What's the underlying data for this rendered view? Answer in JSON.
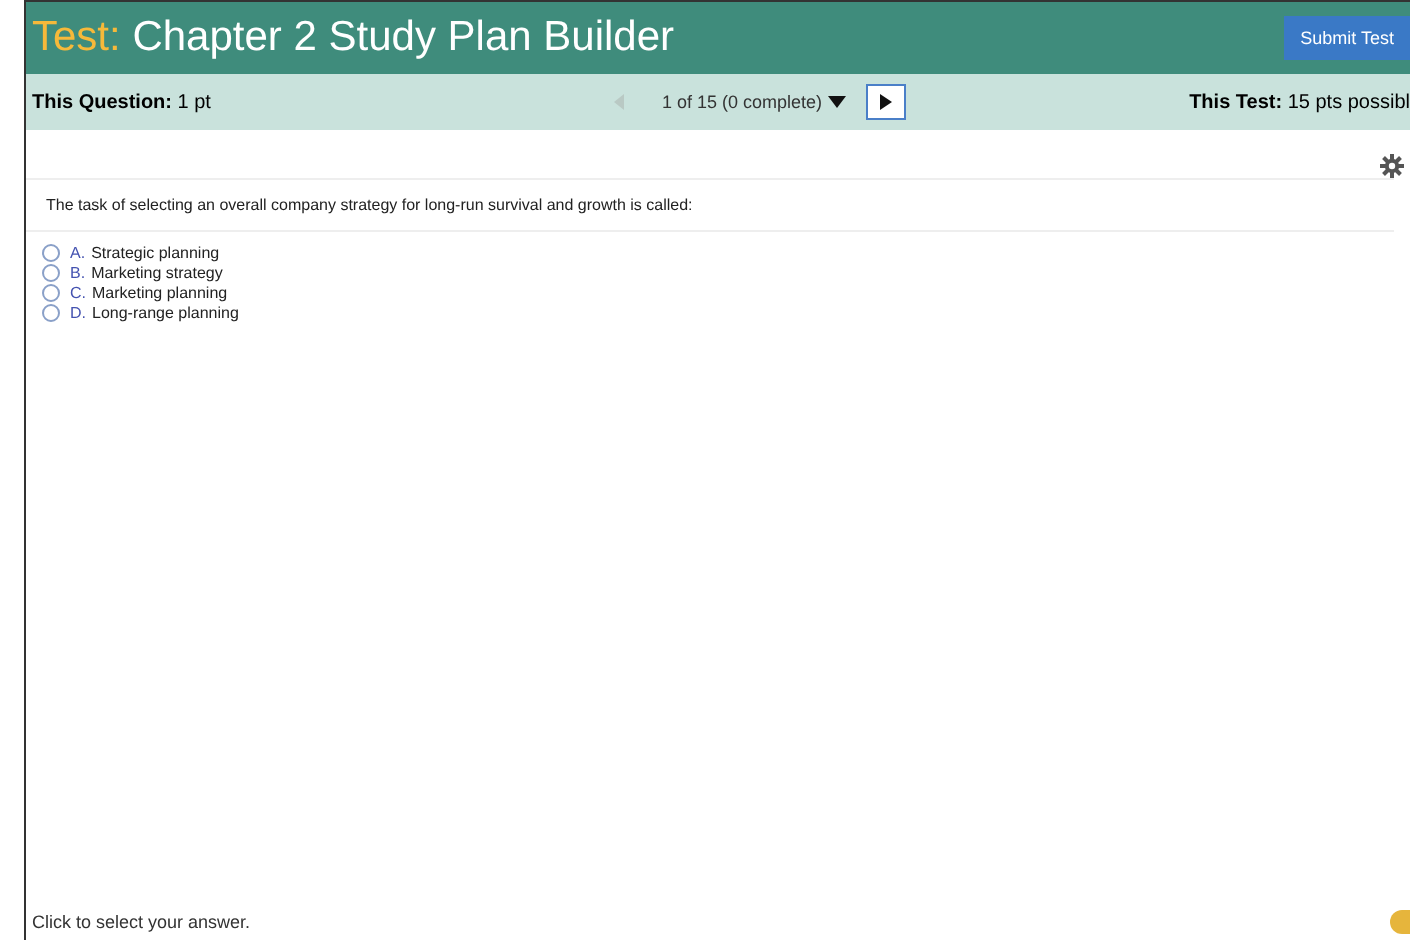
{
  "header": {
    "prefix": "Test:",
    "title": "Chapter 2 Study Plan Builder",
    "submit_button": "Submit Test"
  },
  "info_bar": {
    "question_label": "This Question:",
    "question_value": "1 pt",
    "progress": "1 of 15 (0 complete)",
    "test_label": "This Test:",
    "test_value": "15 pts possibl"
  },
  "question": {
    "text": "The task of selecting an overall company strategy for long-run survival and growth is called:",
    "options": [
      {
        "letter": "A.",
        "text": "Strategic planning",
        "selected": false
      },
      {
        "letter": "B.",
        "text": "Marketing strategy",
        "selected": false
      },
      {
        "letter": "C.",
        "text": "Marketing planning",
        "selected": false
      },
      {
        "letter": "D.",
        "text": "Long-range planning",
        "selected": false
      }
    ]
  },
  "status_bar": {
    "hint": "Click to select your answer."
  }
}
